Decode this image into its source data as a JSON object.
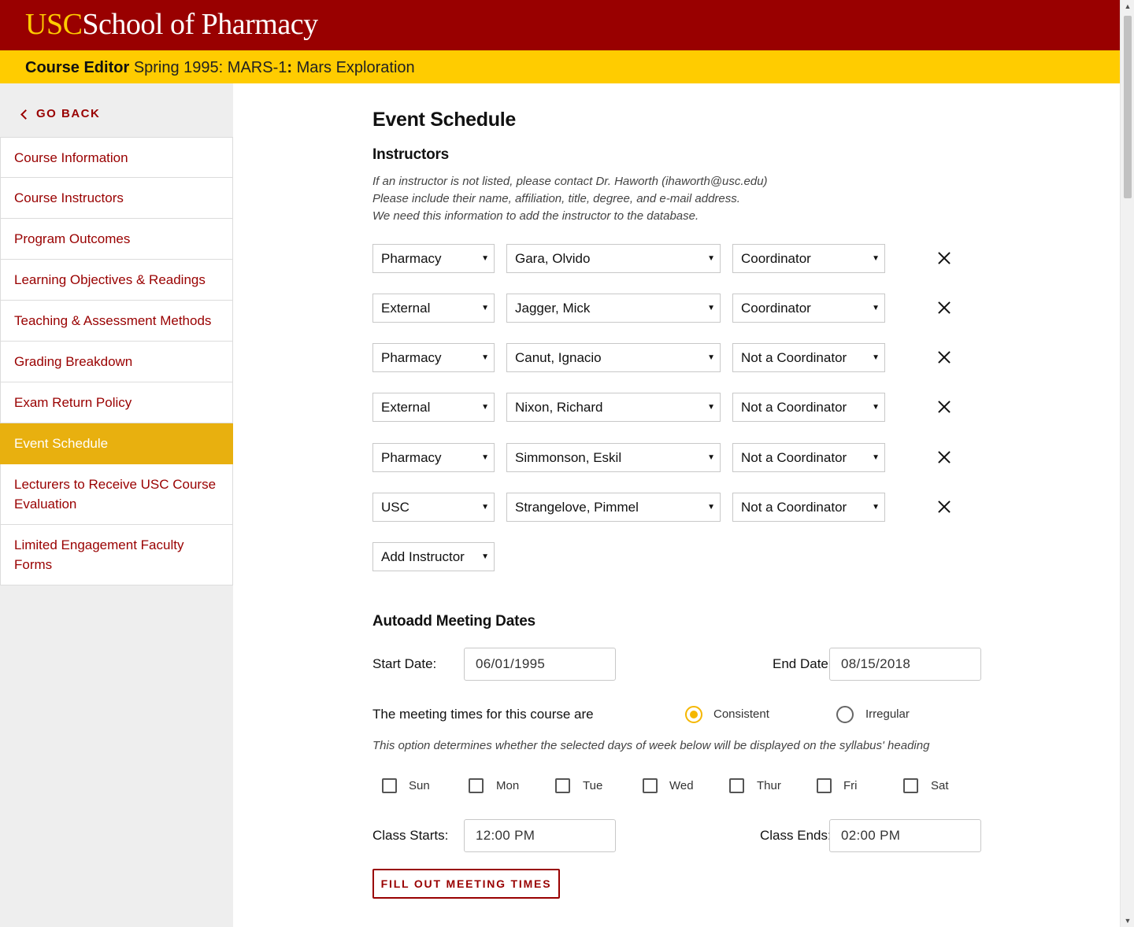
{
  "header": {
    "brand_usc": "USC",
    "brand_rest": "School of Pharmacy",
    "editor_label": "Course Editor",
    "term": "Spring 1995: MARS-1",
    "separator": ":",
    "course_name": "Mars Exploration"
  },
  "sidebar": {
    "go_back": "GO BACK",
    "items": [
      {
        "label": "Course Information"
      },
      {
        "label": "Course Instructors"
      },
      {
        "label": "Program Outcomes"
      },
      {
        "label": "Learning Objectives & Readings"
      },
      {
        "label": "Teaching & Assessment Methods"
      },
      {
        "label": "Grading Breakdown"
      },
      {
        "label": "Exam Return Policy"
      },
      {
        "label": "Event Schedule"
      },
      {
        "label": "Lecturers to Receive USC Course Evaluation"
      },
      {
        "label": "Limited Engagement Faculty Forms"
      }
    ],
    "active_item": "Event Schedule"
  },
  "main": {
    "title": "Event Schedule",
    "instructors": {
      "heading": "Instructors",
      "note_lines": [
        "If an instructor is not listed, please contact Dr. Haworth (ihaworth@usc.edu)",
        "Please include their name, affiliation, title, degree, and e-mail address.",
        "We need this information to add the instructor to the database."
      ],
      "rows": [
        {
          "affiliation": "Pharmacy",
          "name": "Gara, Olvido",
          "role": "Coordinator"
        },
        {
          "affiliation": "External",
          "name": "Jagger, Mick",
          "role": "Coordinator"
        },
        {
          "affiliation": "Pharmacy",
          "name": "Canut, Ignacio",
          "role": "Not a Coordinator"
        },
        {
          "affiliation": "External",
          "name": "Nixon, Richard",
          "role": "Not a Coordinator"
        },
        {
          "affiliation": "Pharmacy",
          "name": "Simmonson, Eskil",
          "role": "Not a Coordinator"
        },
        {
          "affiliation": "USC",
          "name": "Strangelove, Pimmel",
          "role": "Not a Coordinator"
        }
      ],
      "add_label": "Add Instructor"
    },
    "meeting": {
      "heading": "Autoadd Meeting Dates",
      "start_label": "Start Date:",
      "start_value": "06/01/1995",
      "end_label": "End Date:",
      "end_value": "08/15/2018",
      "times_label": "The meeting times for this course are",
      "options": [
        {
          "label": "Consistent",
          "selected": true
        },
        {
          "label": "Irregular",
          "selected": false
        }
      ],
      "option_note": "This option determines whether the selected days of week below will be displayed on the syllabus' heading",
      "days": [
        "Sun",
        "Mon",
        "Tue",
        "Wed",
        "Thur",
        "Fri",
        "Sat"
      ],
      "class_starts_label": "Class Starts:",
      "class_starts_value": "12:00 PM",
      "class_ends_label": "Class Ends:",
      "class_ends_value": "02:00 PM",
      "fill_button": "FILL OUT MEETING TIMES"
    }
  },
  "colors": {
    "cardinal": "#990000",
    "gold": "#ffcc00",
    "active_nav": "#e8b00f",
    "radio_selected": "#f5b700"
  }
}
